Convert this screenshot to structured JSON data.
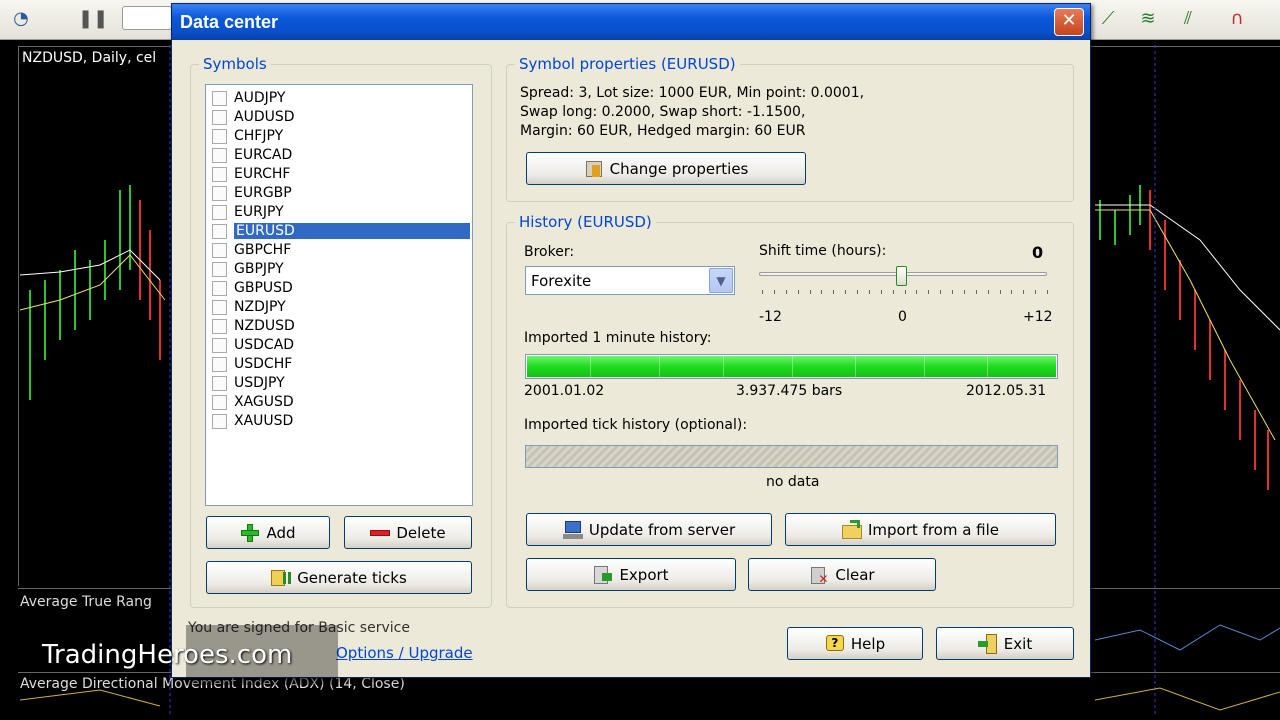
{
  "chart": {
    "title": "NZDUSD, Daily, cel",
    "indicator1": "Average True Rang",
    "indicator2": "Average Directional Movement Index (ADX) (14, Close)"
  },
  "dialog": {
    "title": "Data center",
    "close": "✕",
    "symbols_group": "Symbols",
    "symbols": [
      "AUDJPY",
      "AUDUSD",
      "CHFJPY",
      "EURCAD",
      "EURCHF",
      "EURGBP",
      "EURJPY",
      "EURUSD",
      "GBPCHF",
      "GBPJPY",
      "GBPUSD",
      "NZDJPY",
      "NZDUSD",
      "USDCAD",
      "USDCHF",
      "USDJPY",
      "XAGUSD",
      "XAUUSD"
    ],
    "selected_symbol": "EURUSD",
    "add": "Add",
    "delete": "Delete",
    "generate_ticks": "Generate ticks",
    "props_group": "Symbol properties (EURUSD)",
    "props_line1": "Spread: 3, Lot size: 1000 EUR, Min point: 0.0001,",
    "props_line2": "Swap long: 0.2000, Swap short: -1.1500,",
    "props_line3": "Margin: 60 EUR, Hedged margin: 60 EUR",
    "change_properties": "Change properties",
    "history_group": "History (EURUSD)",
    "broker_label": "Broker:",
    "broker_value": "Forexite",
    "shift_label": "Shift time (hours):",
    "shift_value": "0",
    "shift_min": "-12",
    "shift_mid": "0",
    "shift_max": "+12",
    "minute_label": "Imported 1 minute history:",
    "minute_fill": 1.0,
    "minute_start": "2001.01.02",
    "minute_bars": "3.937.475 bars",
    "minute_end": "2012.05.31",
    "tick_label": "Imported tick history (optional):",
    "tick_status": "no data",
    "update": "Update from server",
    "import": "Import from a file",
    "export": "Export",
    "clear": "Clear",
    "signed": "You are signed for Basic service",
    "upgrade": "Options / Upgrade",
    "help": "Help",
    "exit": "Exit"
  },
  "watermark": "TradingHeroes.com"
}
